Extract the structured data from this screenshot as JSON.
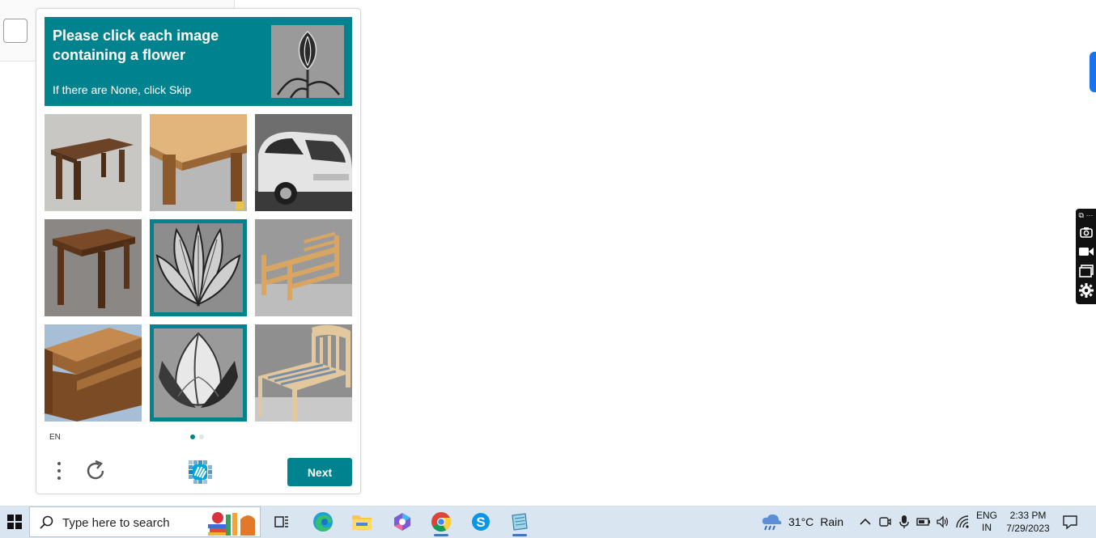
{
  "captcha": {
    "prompt_title": "Please click each image containing a flower",
    "prompt_subtitle": "If there are None, click Skip",
    "language": "EN",
    "next_label": "Next",
    "page_indicator": {
      "current": 1,
      "total": 2
    },
    "accent_color": "#00838f",
    "tiles": [
      {
        "content": "wooden table",
        "selected": false
      },
      {
        "content": "light wood table corner",
        "selected": false
      },
      {
        "content": "silver car",
        "selected": false
      },
      {
        "content": "wooden stool table",
        "selected": false
      },
      {
        "content": "flower (grayscale)",
        "selected": true
      },
      {
        "content": "wooden bed frame",
        "selected": false
      },
      {
        "content": "wooden bed",
        "selected": false
      },
      {
        "content": "flower bud (grayscale)",
        "selected": true
      },
      {
        "content": "wooden bed with headboard",
        "selected": false
      }
    ]
  },
  "taskbar": {
    "search_placeholder": "Type here to search",
    "weather": {
      "temp": "31°C",
      "condition": "Rain"
    },
    "language": {
      "line1": "ENG",
      "line2": "IN"
    },
    "clock": {
      "time": "2:33 PM",
      "date": "7/29/2023"
    },
    "apps": [
      "task-view",
      "edge",
      "file-explorer",
      "copilot",
      "chrome",
      "skype",
      "notepad"
    ]
  }
}
